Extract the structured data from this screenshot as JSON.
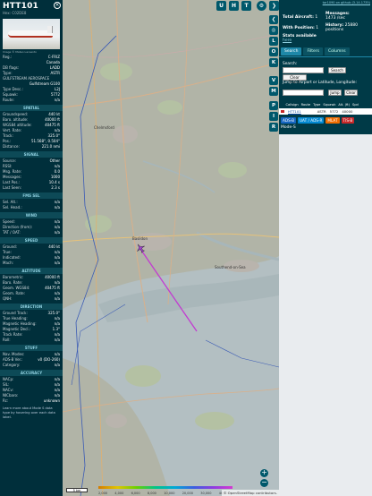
{
  "aircraft": {
    "callsign": "HTT101",
    "hex_label": "Hex:",
    "hex": "C02DE8",
    "photo_credit": "Image © Mateo Lacsanto",
    "reg_label": "Reg.:",
    "reg": "C-FRIZ",
    "country": "Canada",
    "db_flags_label": "DB flags:",
    "db_flags": "LADD",
    "type_label": "Type:",
    "type": "ASTR",
    "manufacturer": "GULFSTREAM AEROSPACE",
    "model": "Gulfstream G100",
    "type_desc_label": "Type Desc.:",
    "type_desc": "L2J",
    "squawk_label": "Squawk:",
    "squawk": "5772",
    "route_label": "Route:",
    "route": "n/a"
  },
  "sections": [
    {
      "title": "SPATIAL",
      "rows": [
        [
          "Groundspeed:",
          "440 kt"
        ],
        [
          "Baro. altitude:",
          "40000 ft"
        ],
        [
          "WGS84 altitude:",
          "40475 ft"
        ],
        [
          "Vert. Rate:",
          "n/a"
        ],
        [
          "Track:",
          "325.0°"
        ],
        [
          "Pos.:",
          "51.568°, 0.504°"
        ],
        [
          "Distance:",
          "221.0 nmi"
        ]
      ]
    },
    {
      "title": "SIGNAL",
      "rows": [
        [
          "Source:",
          "Other"
        ],
        [
          "RSSI:",
          "n/a"
        ],
        [
          "Msg. Rate:",
          "0.0"
        ],
        [
          "Messages:",
          "1000"
        ],
        [
          "Last Pos.:",
          "10.4 s"
        ],
        [
          "Last Seen:",
          "2.3 s"
        ]
      ]
    },
    {
      "title": "FMS SEL",
      "rows": [
        [
          "Sel. Alt.:",
          "n/a"
        ],
        [
          "Sel. Head.:",
          "n/a"
        ]
      ]
    },
    {
      "title": "WIND",
      "rows": [
        [
          "Speed:",
          "n/a"
        ],
        [
          "Direction (from):",
          "n/a"
        ],
        [
          "TAT / OAT:",
          "n/a"
        ]
      ]
    },
    {
      "title": "SPEED",
      "rows": [
        [
          "Ground:",
          "440 kt"
        ],
        [
          "True:",
          "n/a"
        ],
        [
          "Indicated:",
          "n/a"
        ],
        [
          "Mach:",
          "n/a"
        ]
      ]
    },
    {
      "title": "ALTITUDE",
      "rows": [
        [
          "Barometric:",
          "40000 ft"
        ],
        [
          "Baro. Rate:",
          "n/a"
        ],
        [
          "Geom. WGS84:",
          "40475 ft"
        ],
        [
          "Geom. Rate:",
          "n/a"
        ],
        [
          "QNH:",
          "n/a"
        ]
      ]
    },
    {
      "title": "DIRECTION",
      "rows": [
        [
          "Ground Track:",
          "325.0°"
        ],
        [
          "True Heading:",
          "n/a"
        ],
        [
          "Magnetic Heading:",
          "n/a"
        ],
        [
          "Magnetic Decl.:",
          "1.3°"
        ],
        [
          "Track Rate:",
          "n/a"
        ],
        [
          "Roll:",
          "n/a"
        ]
      ]
    },
    {
      "title": "STUFF",
      "rows": [
        [
          "Nav. Modes:",
          "n/a"
        ],
        [
          "ADS-B Ver.:",
          "v0 (DO-260)"
        ],
        [
          "Category:",
          "n/a"
        ]
      ]
    },
    {
      "title": "ACCURACY",
      "rows": [
        [
          "NACp:",
          "n/a"
        ],
        [
          "SIL:",
          "n/a"
        ],
        [
          "NACv:",
          "n/a"
        ],
        [
          "NICbaro:",
          "n/a"
        ],
        [
          "Rc:",
          "unknown"
        ]
      ]
    }
  ],
  "learn_more": "Learn more about Mode S data type by hovering over each data label.",
  "map": {
    "top_buttons": [
      "U",
      "H",
      "T"
    ],
    "side_buttons": [
      "L",
      "O",
      "K",
      "V",
      "M",
      "P",
      "I",
      "R"
    ],
    "places": [
      "Chelmsford",
      "Southend-on-Sea",
      "Basildon"
    ],
    "scale_label": "5 km",
    "attribution": "© OpenStreetMap contributors.",
    "colorbar_ticks": [
      "2,000",
      "4,000",
      "6,000",
      "8,000",
      "10,000",
      "20,000",
      "30,000",
      "40,000+"
    ]
  },
  "stats": {
    "link": "tar1090 on github (3.14.1735)",
    "total_label": "Total Aircraft:",
    "total": "1",
    "with_pos_label": "With Position:",
    "with_pos": "1",
    "messages_label": "Messages:",
    "messages": "1473 /sec",
    "history_label": "History:",
    "history": "25880 positions",
    "stats_available": "Stats available",
    "here": "here"
  },
  "tabs": [
    "Search",
    "Filters",
    "Columns"
  ],
  "search": {
    "search_label": "Search:",
    "search_button": "Search",
    "clear_button": "Clear Search",
    "jump_label": "Jump to Airport or Latitude, Longitude:",
    "jump_button": "Jump",
    "clear2_button": "Clear"
  },
  "table": {
    "columns": [
      "Callsign",
      "Route",
      "Type",
      "Squawk",
      "Alt. (ft)",
      "Spd"
    ],
    "rows": [
      {
        "callsign": "HTT101",
        "type": "ASTR",
        "squawk": "5772",
        "alt": "40000"
      }
    ]
  },
  "sources": [
    "ADS-B",
    "UAT / ADS-R",
    "MLAT",
    "TIS-B"
  ],
  "source_colors": [
    "#1565c0",
    "#0288d1",
    "#ef6c00",
    "#c62828"
  ],
  "mode_s": "Mode-S"
}
